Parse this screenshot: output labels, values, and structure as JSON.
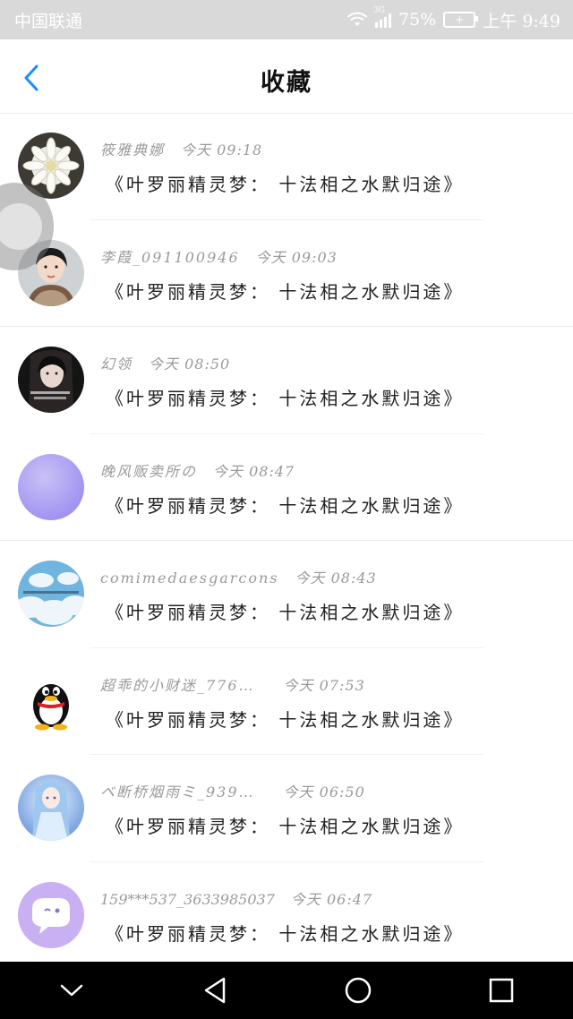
{
  "status_bar": {
    "carrier": "中国联通",
    "network": "3G",
    "battery": "75%",
    "time": "上午 9:49"
  },
  "header": {
    "title": "收藏",
    "back_icon": "chevron-left-icon"
  },
  "favorites": [
    {
      "name": "筱雅典娜",
      "time": "今天 09:18",
      "message": "《叶罗丽精灵梦： 十法相之水默归途》",
      "avatar": "flower-photo"
    },
    {
      "name": "李葭_091100946",
      "time": "今天 09:03",
      "message": "《叶罗丽精灵梦： 十法相之水默归途》",
      "avatar": "girl-photo"
    },
    {
      "name": "幻领",
      "time": "今天 08:50",
      "message": "《叶罗丽精灵梦： 十法相之水默归途》",
      "avatar": "dark-portrait-photo"
    },
    {
      "name": "晚风贩卖所の",
      "time": "今天 08:47",
      "message": "《叶罗丽精灵梦： 十法相之水默归途》",
      "avatar": "purple-gradient"
    },
    {
      "name": "comimedaesgarcons",
      "time": "今天 08:43",
      "message": "《叶罗丽精灵梦： 十法相之水默归途》",
      "avatar": "clouds-photo"
    },
    {
      "name": "超乖的小财迷_776…",
      "time": "今天 07:53",
      "message": "《叶罗丽精灵梦： 十法相之水默归途》",
      "avatar": "penguin-icon"
    },
    {
      "name": "ベ断桥烟雨ミ_939…",
      "time": "今天 06:50",
      "message": "《叶罗丽精灵梦： 十法相之水默归途》",
      "avatar": "anime-girl-photo"
    },
    {
      "name": "159***537_3633985037",
      "time": "今天 06:47",
      "message": "《叶罗丽精灵梦： 十法相之水默归途》",
      "avatar": "chat-bubble-icon"
    }
  ],
  "nav_bar": {
    "icons": [
      "hide-chevron-icon",
      "back-triangle-icon",
      "home-circle-icon",
      "recents-square-icon"
    ]
  },
  "colors": {
    "accent": "#1a8cff",
    "status_bar_bg": "#d9d9d9",
    "secondary_text": "#9a9a9a"
  }
}
